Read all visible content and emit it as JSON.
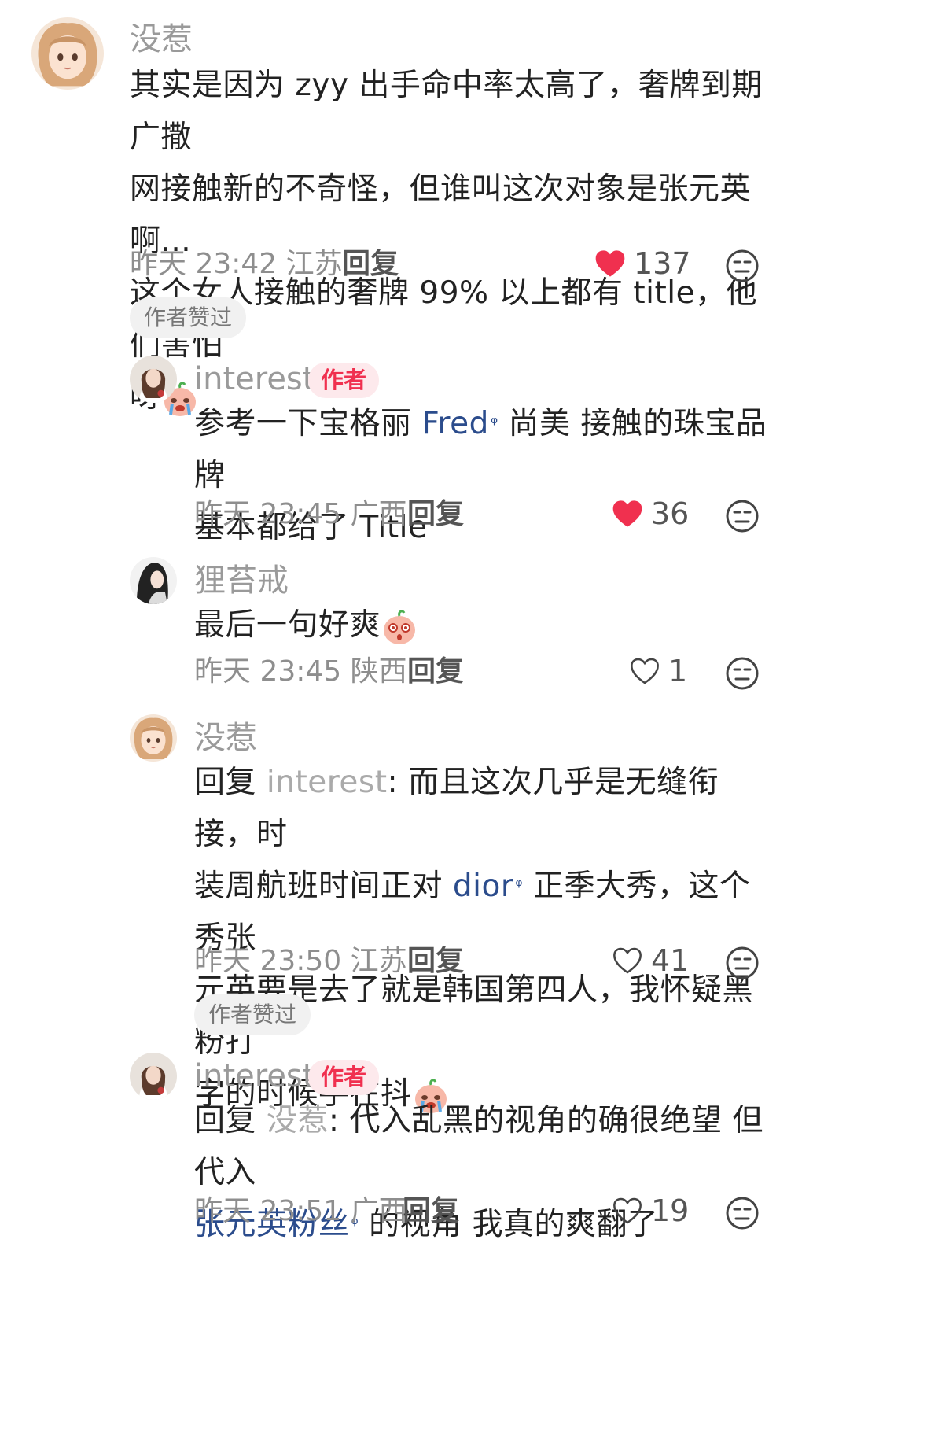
{
  "comments": [
    {
      "name": "没惹",
      "lines": [
        "其实是因为 zyy 出手命中率太高了，奢牌到期广撒",
        "网接触新的不奇怪，但谁叫这次对象是张元英啊...",
        "这个女人接触的奢牌 99% 以上都有 title，他们害怕",
        "呀"
      ],
      "time": "昨天 23:42 江苏",
      "reply": "回复",
      "likes": "137",
      "liked": true,
      "author_liked": "作者赞过"
    },
    {
      "name": "interest",
      "author_tag": "作者",
      "line1_pre": "参考一下宝格丽 ",
      "line1_link": "Fred",
      "line1_post": " 尚美 接触的珠宝品牌",
      "line2": "基本都给了 Title",
      "time": "昨天 23:45 广西",
      "reply": "回复",
      "likes": "36",
      "liked": true
    },
    {
      "name": "狸苔戒",
      "text": "最后一句好爽",
      "time": "昨天 23:45 陕西",
      "reply": "回复",
      "likes": "1",
      "liked": false
    },
    {
      "name": "没惹",
      "reply_prefix": "回复 ",
      "mention": "interest",
      "line1_rest": ": 而且这次几乎是无缝衔接，时",
      "line2_pre": "装周航班时间正对 ",
      "line2_link": "dior",
      "line2_post": " 正季大秀，这个秀张",
      "line3": "元英要是去了就是韩国第四人，我怀疑黑粉打",
      "line4": "字的时候手在抖",
      "time": "昨天 23:50 江苏",
      "reply": "回复",
      "likes": "41",
      "liked": false,
      "author_liked": "作者赞过"
    },
    {
      "name": "interest",
      "author_tag": "作者",
      "reply_prefix": "回复 ",
      "mention": "没惹",
      "line1_rest": ": 代入乱黑的视角的确很绝望 但代入",
      "line2_link": "张元英粉丝",
      "line2_post": " 的视角 我真的爽翻了",
      "time": "昨天 23:51 广西",
      "reply": "回复",
      "likes": "19",
      "liked": false
    }
  ],
  "colors": {
    "heart": "#f0304f",
    "link": "#2b4c8c",
    "mention": "#aaaaaa"
  },
  "icons": {
    "link_suffix": "ᵠ"
  }
}
